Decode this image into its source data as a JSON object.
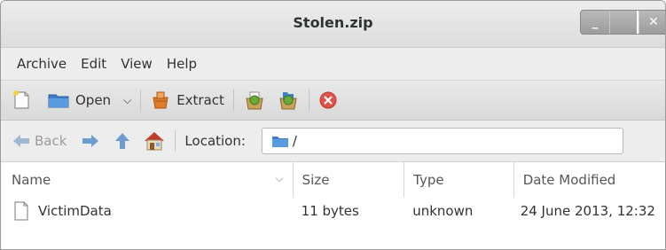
{
  "window": {
    "title": "Stolen.zip",
    "controls": {
      "minimize": "_",
      "close": "✕"
    }
  },
  "menubar": [
    "Archive",
    "Edit",
    "View",
    "Help"
  ],
  "toolbar": {
    "open_label": "Open",
    "extract_label": "Extract",
    "icons": [
      "new-archive-icon",
      "folder-icon",
      "chevron-down-icon",
      "extract-icon",
      "add-files-icon",
      "add-folder-icon",
      "stop-icon"
    ]
  },
  "locationbar": {
    "back_label": "Back",
    "location_label": "Location:",
    "path": "/"
  },
  "columns": {
    "name": "Name",
    "size": "Size",
    "type": "Type",
    "date": "Date Modified"
  },
  "files": [
    {
      "name": "VictimData",
      "size": "11 bytes",
      "type": "unknown",
      "date": "24 June 2013, 12:32"
    }
  ],
  "colors": {
    "accent_blue": "#4a90d9",
    "stop_red": "#e0524a",
    "extract_orange": "#e07b2a",
    "green": "#6aaa3a"
  }
}
